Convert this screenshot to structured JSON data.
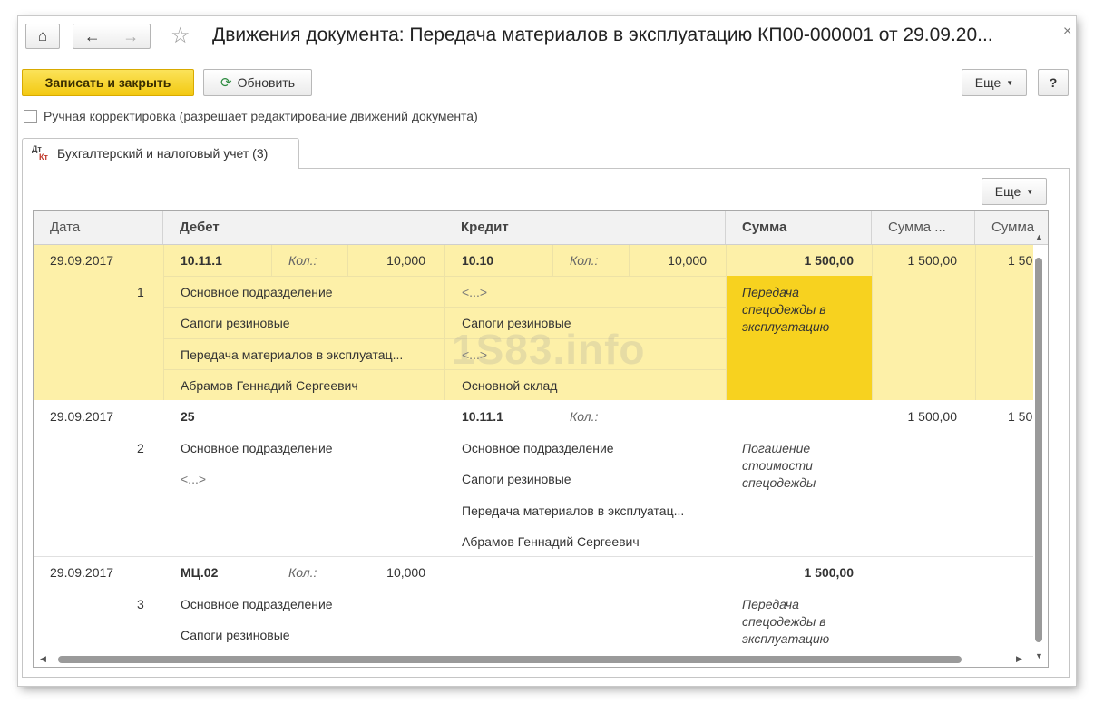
{
  "window": {
    "title": "Движения документа: Передача материалов в эксплуатацию КП00-000001 от 29.09.20...",
    "close_glyph": "×"
  },
  "toolbar": {
    "write_close_label": "Записать и закрыть",
    "refresh_label": "Обновить",
    "more_label": "Еще",
    "help_label": "?"
  },
  "manual_correction": {
    "label": "Ручная корректировка (разрешает редактирование движений документа)",
    "checked": false
  },
  "tabs": [
    {
      "label": "Бухгалтерский и налоговый учет (3)",
      "icon_text_top": "Дт",
      "icon_text_bottom": "Кт"
    }
  ],
  "grid": {
    "more_label": "Еще",
    "columns": [
      "Дата",
      "Дебет",
      "Кредит",
      "Сумма",
      "Сумма ...",
      "Сумма"
    ],
    "rows": [
      {
        "date": "29.09.2017",
        "num": "1",
        "debit_account": "10.11.1",
        "debit_qty_label": "Кол.:",
        "debit_qty": "10,000",
        "debit_sub": [
          "Основное подразделение",
          "Сапоги резиновые",
          "Передача материалов в эксплуатац...",
          "Абрамов Геннадий Сергеевич"
        ],
        "credit_account": "10.10",
        "credit_qty_label": "Кол.:",
        "credit_qty": "10,000",
        "credit_sub": [
          "<...>",
          "Сапоги резиновые",
          "<...>",
          "Основной склад"
        ],
        "sum": "1 500,00",
        "sum2": "1 500,00",
        "sum3": "1 50",
        "content": "Передача спецодежды в эксплуатацию"
      },
      {
        "date": "29.09.2017",
        "num": "2",
        "debit_account": "25",
        "debit_sub": [
          "Основное подразделение",
          "<...>"
        ],
        "credit_account": "10.11.1",
        "credit_qty_label": "Кол.:",
        "credit_sub": [
          "Основное подразделение",
          "Сапоги резиновые",
          "Передача материалов в эксплуатац...",
          "Абрамов Геннадий Сергеевич"
        ],
        "sum2": "1 500,00",
        "sum3": "1 50",
        "content": "Погашение стоимости спецодежды"
      },
      {
        "date": "29.09.2017",
        "num": "3",
        "debit_account": "МЦ.02",
        "debit_qty_label": "Кол.:",
        "debit_qty": "10,000",
        "debit_sub": [
          "Основное подразделение",
          "Сапоги резиновые"
        ],
        "sum": "1 500,00",
        "content": "Передача спецодежды в эксплуатацию"
      }
    ]
  },
  "watermark": "1S83.info",
  "colors": {
    "selected_row": "#fdf0a8",
    "selected_cell": "#f7d21f",
    "primary_button": "#f5cf2a"
  }
}
